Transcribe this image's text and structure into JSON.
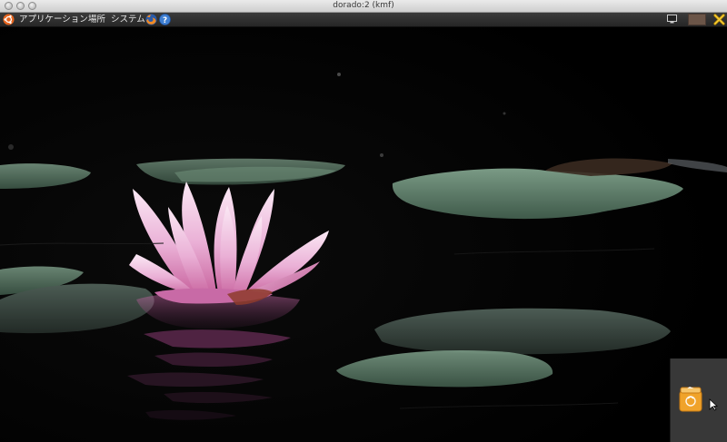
{
  "window": {
    "title": "dorado:2 (kmf)"
  },
  "panel": {
    "menus": [
      "アプリケーション",
      "場所",
      "システム"
    ],
    "icons": [
      "ubuntu-logo-icon",
      "firefox-icon",
      "help-icon",
      "monitor-icon",
      "color-swatch-icon",
      "exit-icon"
    ]
  },
  "desktop": {
    "wallpaper": "pink water lily on dark pond with lily pads",
    "trash_icon": "trash-icon"
  },
  "colors": {
    "panel": "#2f2f2f",
    "titlebar": "#dcdcdc",
    "water": "#000000",
    "pad": "#5a7a64",
    "lily": "#e8a8cf"
  }
}
